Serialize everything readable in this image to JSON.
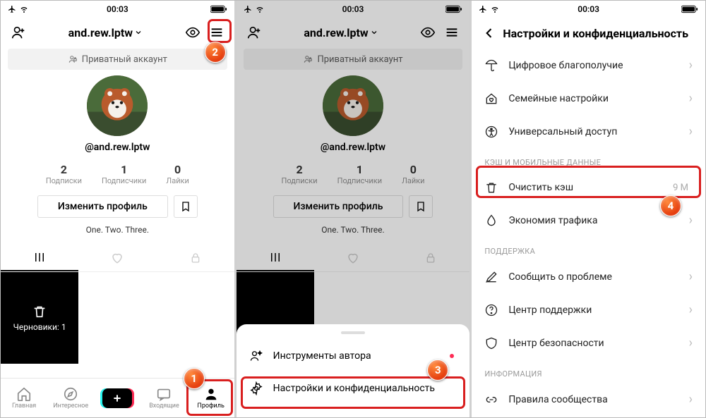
{
  "statusbar": {
    "time": "00:03"
  },
  "profile": {
    "username_title": "and.rew.lptw",
    "handle": "@and.rew.lptw",
    "private_banner": "Приватный аккаунт",
    "stats": [
      {
        "num": "2",
        "lbl": "Подписки"
      },
      {
        "num": "1",
        "lbl": "Подписчики"
      },
      {
        "num": "0",
        "lbl": "Лайки"
      }
    ],
    "edit_btn": "Изменить профиль",
    "bio": "One. Two. Three.",
    "drafts": "Черновики: 1"
  },
  "bottomnav": {
    "home": "Главная",
    "discover": "Интересное",
    "inbox": "Входящие",
    "profile": "Профиль"
  },
  "sheet": {
    "creator": "Инструменты автора",
    "settings": "Настройки и конфиденциальность"
  },
  "settings": {
    "title": "Настройки и конфиденциальность",
    "rows": {
      "wellbeing": "Цифровое благополучие",
      "family": "Семейные настройки",
      "accessibility": "Универсальный доступ",
      "sec_cache": "КЭШ И МОБИЛЬНЫЕ ДАННЫЕ",
      "clear_cache": "Очистить кэш",
      "clear_cache_val": "9 M",
      "datasaver": "Экономия трафика",
      "sec_support": "ПОДДЕРЖКА",
      "report": "Сообщить о проблеме",
      "help": "Центр поддержки",
      "safety": "Центр безопасности",
      "sec_info": "ИНФОРМАЦИЯ",
      "guidelines": "Правила сообщества"
    }
  },
  "callouts": {
    "c1": "1",
    "c2": "2",
    "c3": "3",
    "c4": "4"
  }
}
